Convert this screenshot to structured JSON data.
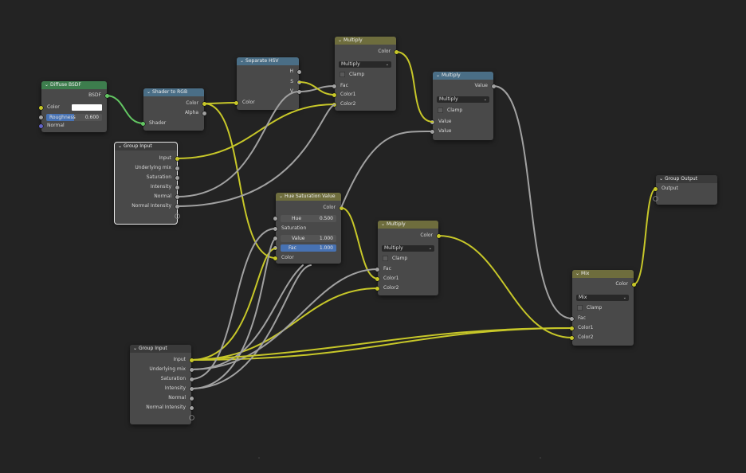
{
  "colors": {
    "background": "#232323",
    "node_body": "#494949",
    "header_shader": "#3d7d4d",
    "header_converter": "#4a6e86",
    "header_color": "#6e6d3d",
    "header_group": "#3a3a3a",
    "link_yellow": "#c7c729",
    "link_gray": "#a1a1a1",
    "link_green": "#63c763"
  },
  "nodes": {
    "diffuse_bsdf": {
      "title": "Diffuse BSDF",
      "bsdf": "BSDF",
      "color": "Color",
      "roughness_label": "Roughness",
      "roughness_value": "0.600",
      "normal": "Normal"
    },
    "shader_to_rgb": {
      "title": "Shader to RGB",
      "color": "Color",
      "alpha": "Alpha",
      "shader": "Shader"
    },
    "separate_hsv": {
      "title": "Separate HSV",
      "h": "H",
      "s": "S",
      "v": "V",
      "color": "Color"
    },
    "multiply_top": {
      "title": "Multiply",
      "color_out": "Color",
      "mode": "Multiply",
      "clamp": "Clamp",
      "fac": "Fac",
      "color1": "Color1",
      "color2": "Color2"
    },
    "multiply_math": {
      "title": "Multiply",
      "value_out": "Value",
      "mode": "Multiply",
      "clamp": "Clamp",
      "value1": "Value",
      "value2": "Value"
    },
    "group_input_top": {
      "title": "Group Input",
      "outputs": [
        "Input",
        "Underlying mix",
        "Saturation",
        "Intensity",
        "Normal",
        "Normal Intensity"
      ]
    },
    "hue_sat_val": {
      "title": "Hue Saturation Value",
      "color_out": "Color",
      "hue_label": "Hue",
      "hue_value": "0.500",
      "saturation": "Saturation",
      "value_label": "Value",
      "value_value": "1.000",
      "fac_label": "Fac",
      "fac_value": "1.000",
      "color_in": "Color"
    },
    "multiply_mid": {
      "title": "Multiply",
      "color_out": "Color",
      "mode": "Multiply",
      "clamp": "Clamp",
      "fac": "Fac",
      "color1": "Color1",
      "color2": "Color2"
    },
    "group_output": {
      "title": "Group Output",
      "output": "Output"
    },
    "mix": {
      "title": "Mix",
      "color_out": "Color",
      "mode": "Mix",
      "clamp": "Clamp",
      "fac": "Fac",
      "color1": "Color1",
      "color2": "Color2"
    },
    "group_input_bottom": {
      "title": "Group Input",
      "outputs": [
        "Input",
        "Underlying mix",
        "Saturation",
        "Intensity",
        "Normal",
        "Normal Intensity"
      ]
    }
  },
  "icons": {
    "collapse": "chevron-down-icon",
    "dropdown": "chevron-down-icon",
    "checkbox": "checkbox-icon"
  }
}
